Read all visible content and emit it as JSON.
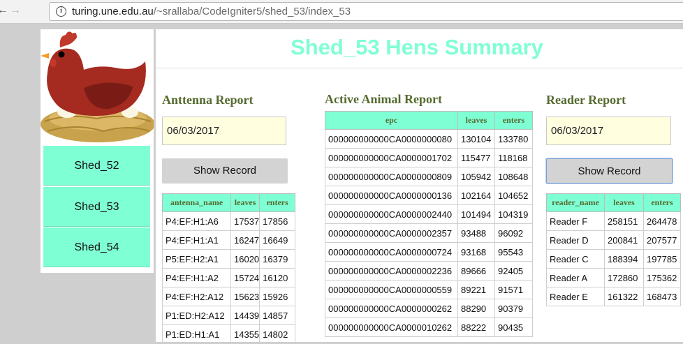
{
  "browser": {
    "url_host": "turing.une.edu.au",
    "url_path": "/~srallaba/CodeIgniter5/shed_53/index_53"
  },
  "sidebar": {
    "sheds": [
      "Shed_52",
      "Shed_53",
      "Shed_54"
    ]
  },
  "page": {
    "title": "Shed_53 Hens Summary"
  },
  "antenna": {
    "title": "Anttenna Report",
    "date": "06/03/2017",
    "button": "Show Record",
    "headers": [
      "antenna_name",
      "leaves",
      "enters"
    ],
    "rows": [
      [
        "P4:EF:H1:A6",
        "17537",
        "17856"
      ],
      [
        "P4:EF:H1:A1",
        "16247",
        "16649"
      ],
      [
        "P5:EF:H2:A1",
        "16020",
        "16379"
      ],
      [
        "P4:EF:H1:A2",
        "15724",
        "16120"
      ],
      [
        "P4:EF:H2:A12",
        "15623",
        "15926"
      ],
      [
        "P1:ED:H2:A12",
        "14439",
        "14857"
      ],
      [
        "P1:ED:H1:A1",
        "14355",
        "14802"
      ]
    ]
  },
  "active": {
    "title": "Active Animal Report",
    "headers": [
      "epc",
      "leaves",
      "enters"
    ],
    "rows": [
      [
        "000000000000CA0000000080",
        "130104",
        "133780"
      ],
      [
        "000000000000CA0000001702",
        "115477",
        "118168"
      ],
      [
        "000000000000CA0000000809",
        "105942",
        "108648"
      ],
      [
        "000000000000CA0000000136",
        "102164",
        "104652"
      ],
      [
        "000000000000CA0000002440",
        "101494",
        "104319"
      ],
      [
        "000000000000CA0000002357",
        "93488",
        "96092"
      ],
      [
        "000000000000CA0000000724",
        "93168",
        "95543"
      ],
      [
        "000000000000CA0000002236",
        "89666",
        "92405"
      ],
      [
        "000000000000CA0000000559",
        "89221",
        "91571"
      ],
      [
        "000000000000CA0000000262",
        "88290",
        "90379"
      ],
      [
        "000000000000CA0000010262",
        "88222",
        "90435"
      ]
    ]
  },
  "reader": {
    "title": "Reader Report",
    "date": "06/03/2017",
    "button": "Show Record",
    "headers": [
      "reader_name",
      "leaves",
      "enters"
    ],
    "rows": [
      [
        "Reader F",
        "258151",
        "264478"
      ],
      [
        "Reader D",
        "200841",
        "207577"
      ],
      [
        "Reader C",
        "188394",
        "197785"
      ],
      [
        "Reader A",
        "172860",
        "175362"
      ],
      [
        "Reader E",
        "161322",
        "168473"
      ]
    ]
  },
  "colors": {
    "accent": "#7fffd4",
    "heading": "#556b2f",
    "date_field": "#ffffe0",
    "button": "#d3d3d3"
  }
}
